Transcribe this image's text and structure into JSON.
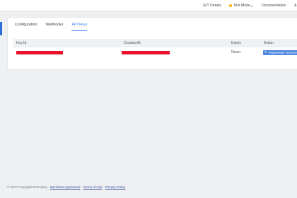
{
  "topnav": {
    "git_details": "GIT Details",
    "mode": "Test Mode",
    "documentation": "Documentation",
    "cut_item": "A"
  },
  "tabs": [
    {
      "label": "Configuration"
    },
    {
      "label": "Webhooks"
    },
    {
      "label": "API Keys",
      "active": true
    }
  ],
  "table": {
    "headers": [
      "Key Id",
      "Created At",
      "Expiry",
      "Action"
    ],
    "rows": [
      {
        "expiry": "Never",
        "action": "Regenerate Test Key"
      }
    ]
  },
  "footer": {
    "copyright": "© 2017 Copyright Razorpay ·",
    "merchant": "Merchant Agreement",
    "sep1": "·",
    "terms": "Terms of Use",
    "sep2": "·",
    "privacy": "Privacy Policy"
  },
  "colors": {
    "accent": "#3d7ff0",
    "redaction": "#e8102a",
    "mode_dot": "#f4b400"
  }
}
